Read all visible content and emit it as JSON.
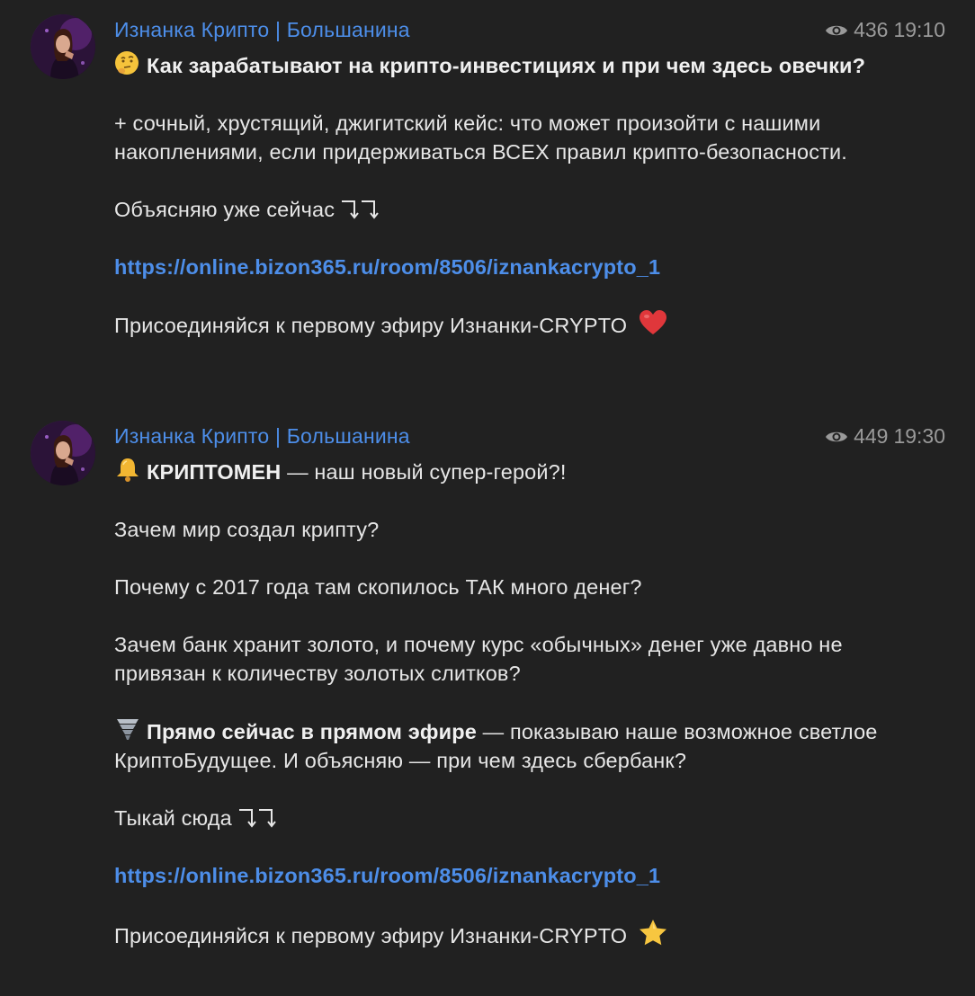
{
  "messages": [
    {
      "sender": "Изнанка Крипто | Большанина",
      "views": "436",
      "time": "19:10",
      "title_emoji": "thinking-face",
      "title": "Как зарабатывают на крипто-инвестициях и при чем здесь овечки?",
      "p1": "+ сочный, хрустящий, джигитский кейс: что может произойти с нашими накоплениями, если придерживаться ВСЕХ правил крипто-безопасности.",
      "p2": "Объясняю уже сейчас",
      "link": "https://online.bizon365.ru/room/8506/iznankacrypto_1",
      "footer": "Присоединяйся к первому эфиру Изнанки-CRYPTO",
      "footer_emoji": "red-heart"
    },
    {
      "sender": "Изнанка Крипто | Большанина",
      "views": "449",
      "time": "19:30",
      "title_emoji": "bell",
      "title_bold": "КРИПТОМЕН",
      "title_rest": " — наш новый супер-герой?!",
      "q1": "Зачем мир создал крипту?",
      "q2": "Почему с 2017 года там скопилось ТАК много денег?",
      "q3": "Зачем банк хранит золото, и почему курс «обычных» денег уже давно не привязан к количеству золотых слитков?",
      "live_emoji": "tornado",
      "live_bold": "Прямо сейчас в прямом эфире",
      "live_rest": " — показываю наше возможное светлое КриптоБудущее. И объясняю — при чем здесь сбербанк?",
      "cta": "Тыкай сюда",
      "link": "https://online.bizon365.ru/room/8506/iznankacrypto_1",
      "footer": "Присоединяйся к первому эфиру Изнанки-CRYPTO",
      "footer_emoji": "star"
    }
  ],
  "colors": {
    "background": "#212121",
    "accent": "#4d8ee9",
    "meta": "#9a9a9a",
    "text": "#e6e6e6"
  }
}
